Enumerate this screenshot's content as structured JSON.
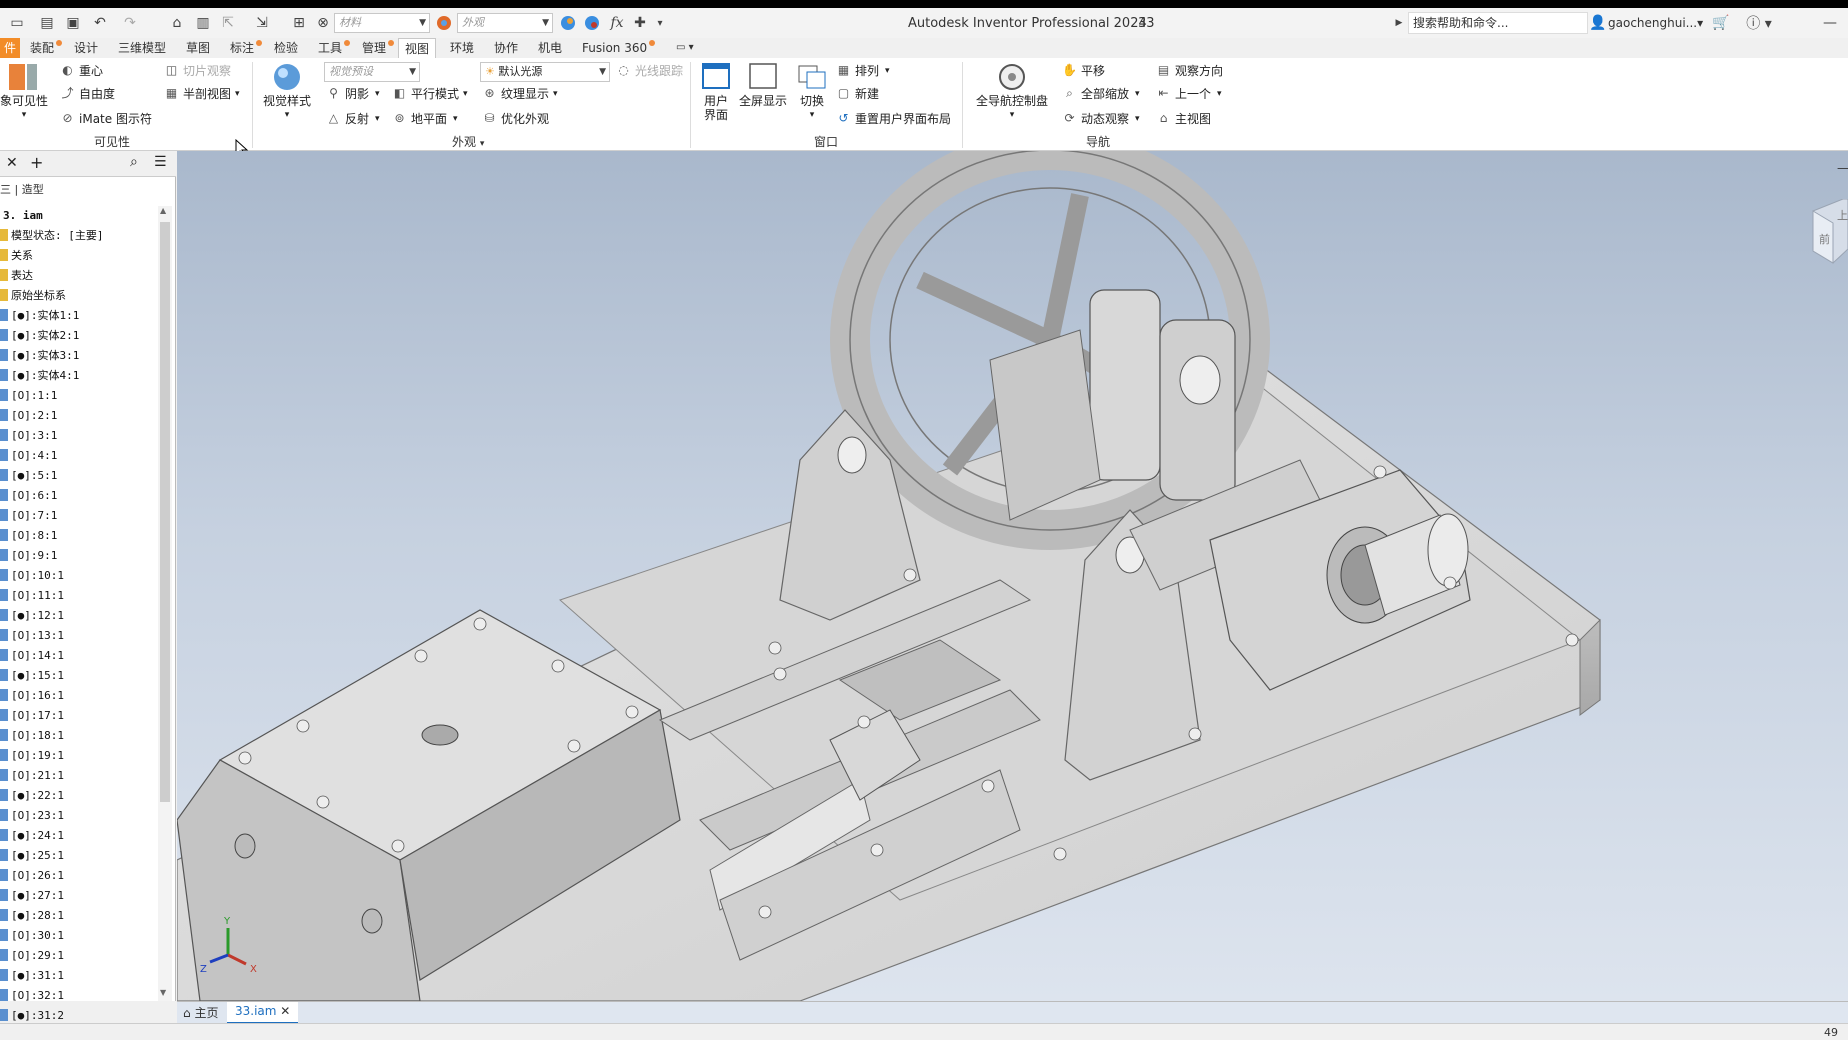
{
  "app": {
    "title": "Autodesk Inventor Professional 2024",
    "doc_number": "33",
    "search_placeholder": "搜索帮助和命令...",
    "user": "gaochenghui..."
  },
  "quick_access": {
    "material_placeholder": "材料",
    "appearance_placeholder": "外观"
  },
  "tabs": [
    {
      "label": "件",
      "icon": "orange-tab"
    },
    {
      "label": "装配"
    },
    {
      "label": "设计"
    },
    {
      "label": "三维模型"
    },
    {
      "label": "草图"
    },
    {
      "label": "标注"
    },
    {
      "label": "检验"
    },
    {
      "label": "工具"
    },
    {
      "label": "管理"
    },
    {
      "label": "视图",
      "active": true
    },
    {
      "label": "环境"
    },
    {
      "label": "协作"
    },
    {
      "label": "机电"
    },
    {
      "label": "Fusion 360"
    }
  ],
  "ribbon": {
    "visibility": {
      "big_label": "象可见性",
      "center_of_gravity": "重心",
      "free_dof": "自由度",
      "imate": "iMate 图示符",
      "slice": "切片观察",
      "half_section": "半剖视图",
      "group_label": "可见性"
    },
    "appearance": {
      "visual_style": "视觉样式",
      "preset_placeholder": "视觉预设",
      "light_source": "默认光源",
      "ray_tracing": "光线跟踪",
      "shadow": "阴影",
      "reflection": "反射",
      "parallel_mode": "平行模式",
      "ground_plane": "地平面",
      "texture": "纹理显示",
      "optimize": "优化外观",
      "group_label": "外观"
    },
    "window": {
      "user_interface_1": "用户",
      "user_interface_2": "界面",
      "fullscreen": "全屏显示",
      "switch": "切换",
      "arrange": "排列",
      "new": "新建",
      "reset_layout": "重置用户界面布局",
      "group_label": "窗口"
    },
    "navigate": {
      "nav_wheel": "全导航控制盘",
      "pan": "平移",
      "zoom_all": "全部缩放",
      "orbit": "动态观察",
      "look_at": "观察方向",
      "previous": "上一个",
      "home": "主视图",
      "group_label": "导航"
    }
  },
  "browser": {
    "tab_label": "造型",
    "tree": [
      "3. iam",
      "模型状态: [主要]",
      "关系",
      "表达",
      "原始坐标系",
      "[●]:实体1:1",
      "[●]:实体2:1",
      "[●]:实体3:1",
      "[●]:实体4:1",
      "[O]:1:1",
      "[O]:2:1",
      "[O]:3:1",
      "[O]:4:1",
      "[●]:5:1",
      "[O]:6:1",
      "[O]:7:1",
      "[O]:8:1",
      "[O]:9:1",
      "[O]:10:1",
      "[O]:11:1",
      "[●]:12:1",
      "[O]:13:1",
      "[O]:14:1",
      "[●]:15:1",
      "[O]:16:1",
      "[O]:17:1",
      "[O]:18:1",
      "[O]:19:1",
      "[O]:21:1",
      "[●]:22:1",
      "[O]:23:1",
      "[●]:24:1",
      "[●]:25:1",
      "[O]:26:1",
      "[●]:27:1",
      "[●]:28:1",
      "[O]:30:1",
      "[O]:29:1",
      "[●]:31:1",
      "[O]:32:1",
      "[●]:31:2"
    ]
  },
  "viewport": {
    "viewcube_front": "前",
    "viewcube_top": "上",
    "axis_x": "X",
    "axis_y": "Y",
    "axis_z": "Z"
  },
  "doc_tabs": {
    "home": "主页",
    "active_doc": "33.iam"
  },
  "status": {
    "count": "49"
  },
  "colors": {
    "accent": "#f28c28",
    "ribbon_blue": "#1e6fbf",
    "viewport_top": "#a9b8cc",
    "viewport_bottom": "#dde4ee",
    "model_face": "#d4d4d4"
  }
}
